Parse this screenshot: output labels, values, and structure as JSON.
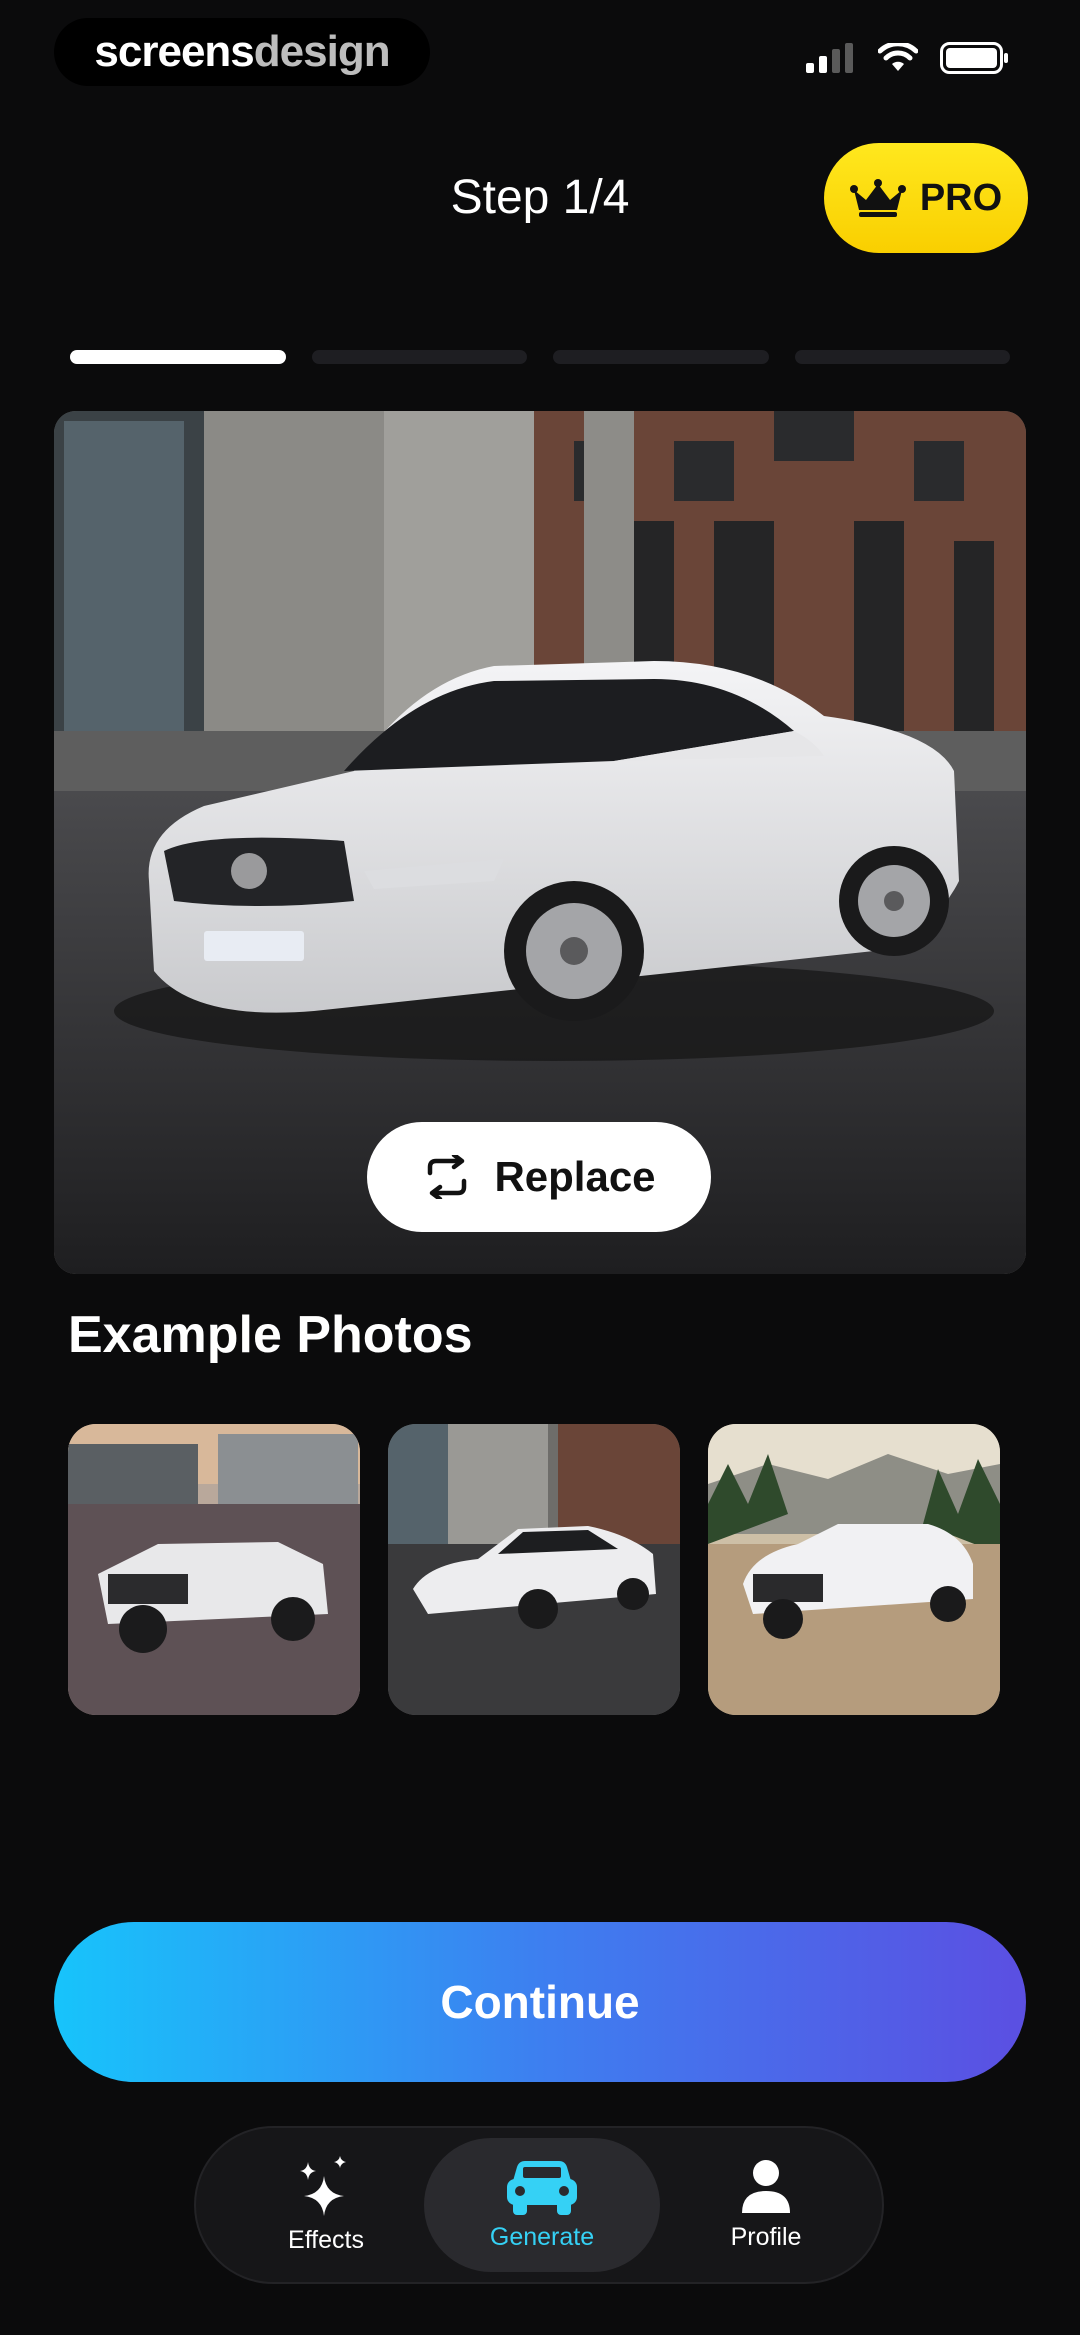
{
  "status_bar": {
    "brand_part1": "screens",
    "brand_part2": "design",
    "signal_icon": "cellular-signal-icon",
    "wifi_icon": "wifi-icon",
    "battery_icon": "battery-icon"
  },
  "header": {
    "title": "Step 1/4",
    "pro_label": "PRO",
    "pro_icon": "crown-icon"
  },
  "progress": {
    "total_steps": 4,
    "current_step": 1
  },
  "main_photo": {
    "replace_label": "Replace",
    "replace_icon": "replace-arrows-icon"
  },
  "examples": {
    "title": "Example Photos",
    "items": [
      "pickup-truck",
      "sedan",
      "suv"
    ]
  },
  "continue_label": "Continue",
  "nav": {
    "items": [
      {
        "label": "Effects",
        "icon": "sparkles-icon"
      },
      {
        "label": "Generate",
        "icon": "car-icon"
      },
      {
        "label": "Profile",
        "icon": "person-icon"
      }
    ],
    "active": "Generate"
  },
  "colors": {
    "pro_yellow": "#ffe81e",
    "continue_start": "#17c4fb",
    "continue_end": "#5b4fe2",
    "nav_active": "#35d1f5"
  }
}
